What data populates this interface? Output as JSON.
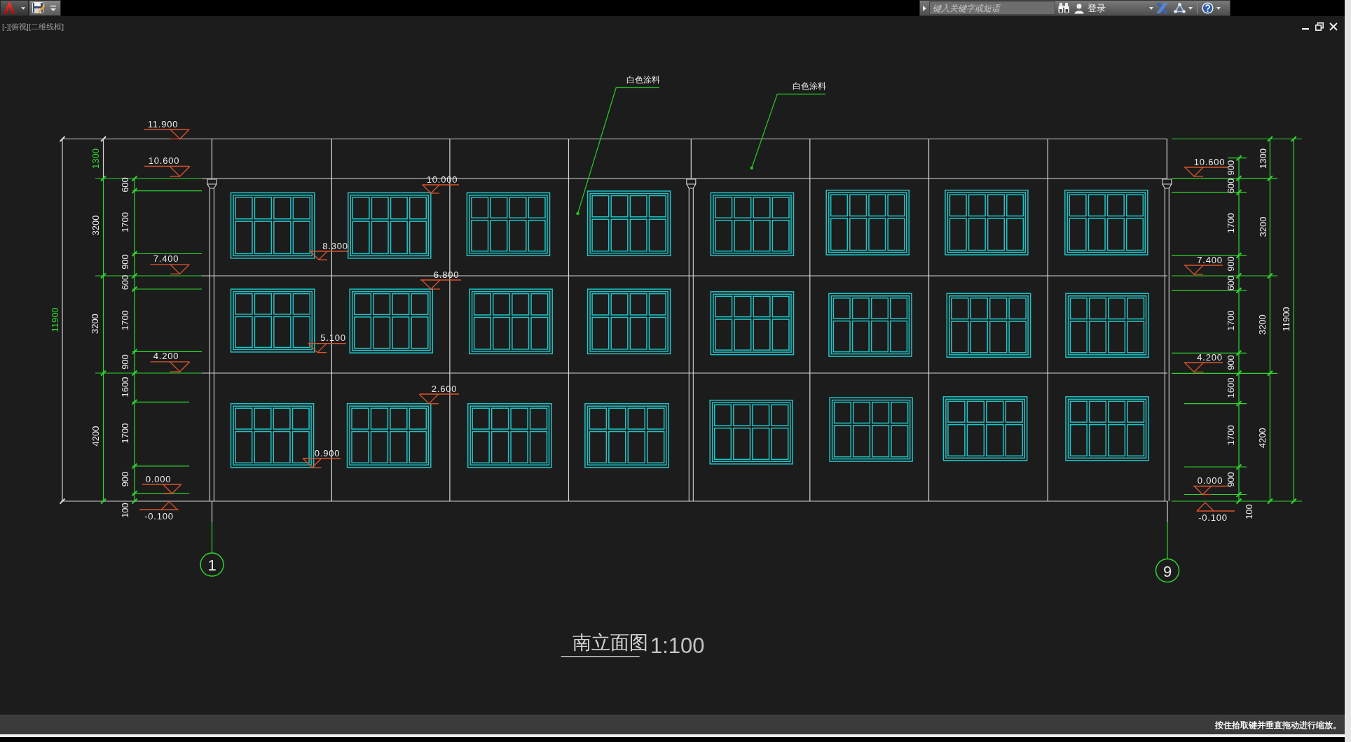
{
  "title_bar": {
    "search": {
      "placeholder": "键入关键字或短语"
    },
    "sign_in": "登录"
  },
  "viewport": {
    "label": "[-][俯视][二维线框]"
  },
  "drawing": {
    "notes": [
      "白色涂料",
      "白色涂料"
    ],
    "left_levels": [
      "11.900",
      "10.600",
      "7.400",
      "4.200",
      "0.000",
      "-0.100"
    ],
    "window_levels": [
      "10.000",
      "8.300",
      "6.800",
      "5.100",
      "2.600",
      "0.900"
    ],
    "right_levels": [
      "10.600",
      "7.400",
      "4.200",
      "0.000",
      "-0.100"
    ],
    "left_dimensions": {
      "total": "11900",
      "floors": [
        "1300",
        "3200",
        "3200",
        "4200"
      ],
      "details": [
        "600",
        "1700",
        "900",
        "600",
        "1700",
        "900",
        "1600",
        "1700",
        "900",
        "100"
      ]
    },
    "right_dimensions": {
      "details": [
        "900",
        "600",
        "1700",
        "900",
        "600",
        "1700",
        "900",
        "1600",
        "1700",
        "900",
        "100"
      ],
      "floors": [
        "1300",
        "3200",
        "3200",
        "4200"
      ],
      "total": "11900"
    },
    "axes": [
      "1",
      "9"
    ],
    "title": "南立面图",
    "scale": "1:100"
  },
  "status_bar": {
    "text": "按住拾取键并垂直拖动进行缩放。"
  }
}
